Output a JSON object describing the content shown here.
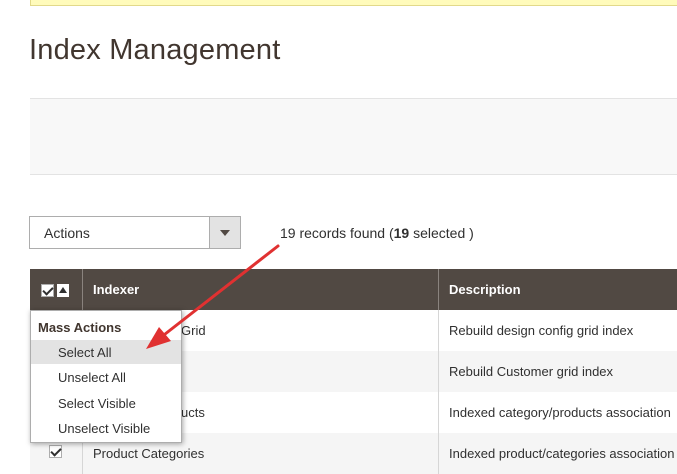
{
  "page": {
    "title": "Index Management"
  },
  "toolbar": {
    "actions_label": "Actions",
    "records_prefix": "19 records found (",
    "records_selected_count": "19",
    "records_suffix": " selected )"
  },
  "grid": {
    "columns": [
      "Indexer",
      "Description"
    ],
    "rows": [
      {
        "indexer": "Grid",
        "description": "Rebuild design config grid index",
        "checked": true
      },
      {
        "indexer": "",
        "description": "Rebuild Customer grid index",
        "checked": true
      },
      {
        "indexer": "ucts",
        "description": "Indexed category/products association",
        "checked": true
      },
      {
        "indexer": "Product Categories",
        "description": "Indexed product/categories association",
        "checked": true
      }
    ]
  },
  "mass_actions": {
    "title": "Mass Actions",
    "items": [
      "Select All",
      "Unselect All",
      "Select Visible",
      "Unselect Visible"
    ]
  },
  "colors": {
    "header_bg": "#514943",
    "annotation_arrow": "#e03131",
    "notice_bg": "#fffbbb"
  }
}
